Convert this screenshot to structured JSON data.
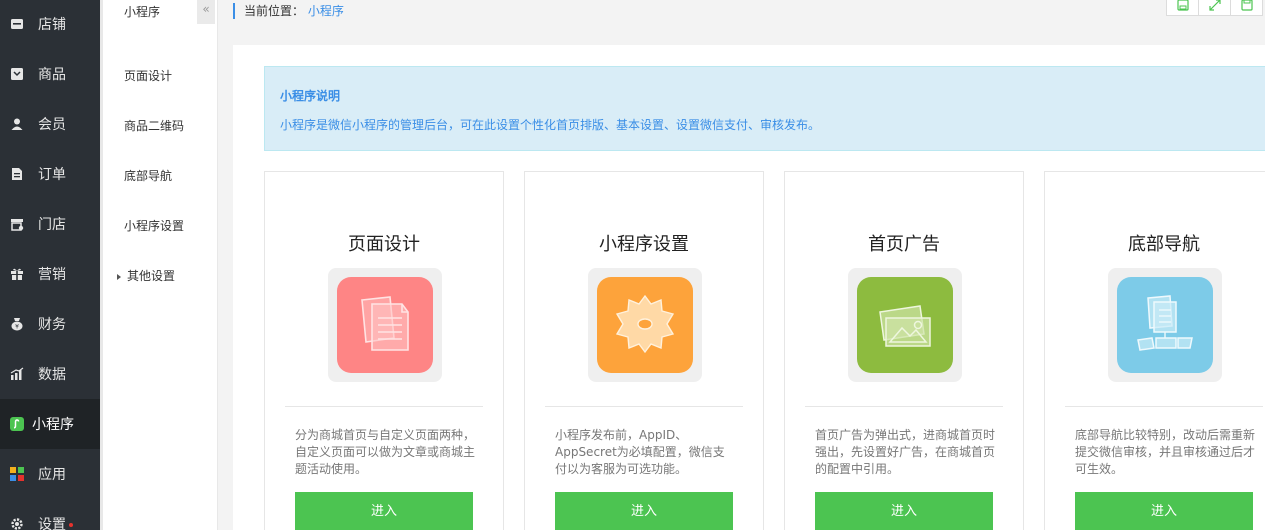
{
  "sidebar": {
    "items": [
      {
        "label": "店铺",
        "icon": "store-icon"
      },
      {
        "label": "商品",
        "icon": "product-icon"
      },
      {
        "label": "会员",
        "icon": "member-icon"
      },
      {
        "label": "订单",
        "icon": "order-icon"
      },
      {
        "label": "门店",
        "icon": "shop-icon"
      },
      {
        "label": "营销",
        "icon": "gift-icon"
      },
      {
        "label": "财务",
        "icon": "finance-icon"
      },
      {
        "label": "数据",
        "icon": "chart-icon"
      },
      {
        "label": "小程序",
        "icon": "miniprogram-icon"
      },
      {
        "label": "应用",
        "icon": "apps-icon"
      },
      {
        "label": "设置",
        "icon": "settings-icon"
      }
    ]
  },
  "subnav": {
    "title": "小程序",
    "collapse_glyph": "«",
    "items": [
      {
        "label": "页面设计"
      },
      {
        "label": "商品二维码"
      },
      {
        "label": "底部导航"
      },
      {
        "label": "小程序设置"
      },
      {
        "label": "其他设置"
      }
    ]
  },
  "breadcrumb": {
    "prefix": "当前位置：",
    "current": "小程序"
  },
  "notice": {
    "title": "小程序说明",
    "text": "小程序是微信小程序的管理后台，可在此设置个性化首页排版、基本设置、设置微信支付、审核发布。"
  },
  "cards": [
    {
      "title": "页面设计",
      "desc": "分为商城首页与自定义页面两种，自定义页面可以做为文章或商城主题活动使用。",
      "button": "进入",
      "color": "#fe8585"
    },
    {
      "title": "小程序设置",
      "desc": "小程序发布前，AppID、AppSecret为必填配置，微信支付以为客服为可选功能。",
      "button": "进入",
      "color": "#fda33b"
    },
    {
      "title": "首页广告",
      "desc": "首页广告为弹出式，进商城首页时强出，先设置好广告，在商城首页的配置中引用。",
      "button": "进入",
      "color": "#8dbb3f"
    },
    {
      "title": "底部导航",
      "desc": "底部导航比较特别，改动后需重新提交微信审核，并且审核通过后才可生效。",
      "button": "进入",
      "color": "#7dcbe8"
    }
  ],
  "colors": {
    "sidebar_bg": "#2b3036",
    "accent_blue": "#3a8ee6",
    "button_green": "#4cc451"
  }
}
